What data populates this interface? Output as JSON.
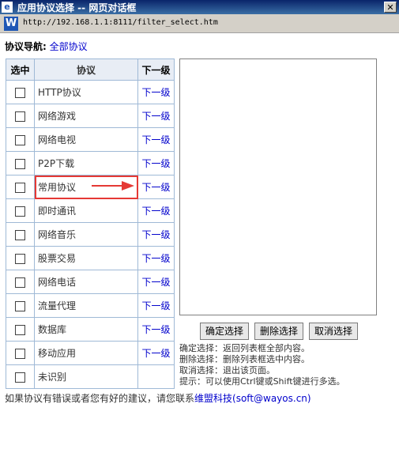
{
  "window": {
    "title": "应用协议选择 -- 网页对话框",
    "url": "http://192.168.1.1:8111/filter_select.htm"
  },
  "nav": {
    "label": "协议导航:",
    "current": "全部协议"
  },
  "table": {
    "headers": [
      "选中",
      "协议",
      "下一级"
    ],
    "rows": [
      {
        "name": "HTTP协议",
        "next": "下一级"
      },
      {
        "name": "网络游戏",
        "next": "下一级"
      },
      {
        "name": "网络电视",
        "next": "下一级"
      },
      {
        "name": "P2P下载",
        "next": "下一级"
      },
      {
        "name": "常用协议",
        "next": "下一级"
      },
      {
        "name": "即时通讯",
        "next": "下一级"
      },
      {
        "name": "网络音乐",
        "next": "下一级"
      },
      {
        "name": "股票交易",
        "next": "下一级"
      },
      {
        "name": "网络电话",
        "next": "下一级"
      },
      {
        "name": "流量代理",
        "next": "下一级"
      },
      {
        "name": "数据库",
        "next": "下一级"
      },
      {
        "name": "移动应用",
        "next": "下一级"
      },
      {
        "name": "未识别",
        "next": ""
      }
    ]
  },
  "buttons": {
    "confirm": "确定选择",
    "delete": "删除选择",
    "cancel": "取消选择"
  },
  "help": [
    "确定选择：返回列表框全部内容。",
    "删除选择：删除列表框选中内容。",
    "取消选择：退出该页面。",
    "提示：可以使用Ctrl键或Shift键进行多选。"
  ],
  "footer": {
    "text": "如果协议有错误或者您有好的建议，请您联系",
    "company": "维盟科技",
    "email": "(soft@wayos.cn)"
  },
  "colors": {
    "accent": "#e53935",
    "link": "#0000cc"
  }
}
